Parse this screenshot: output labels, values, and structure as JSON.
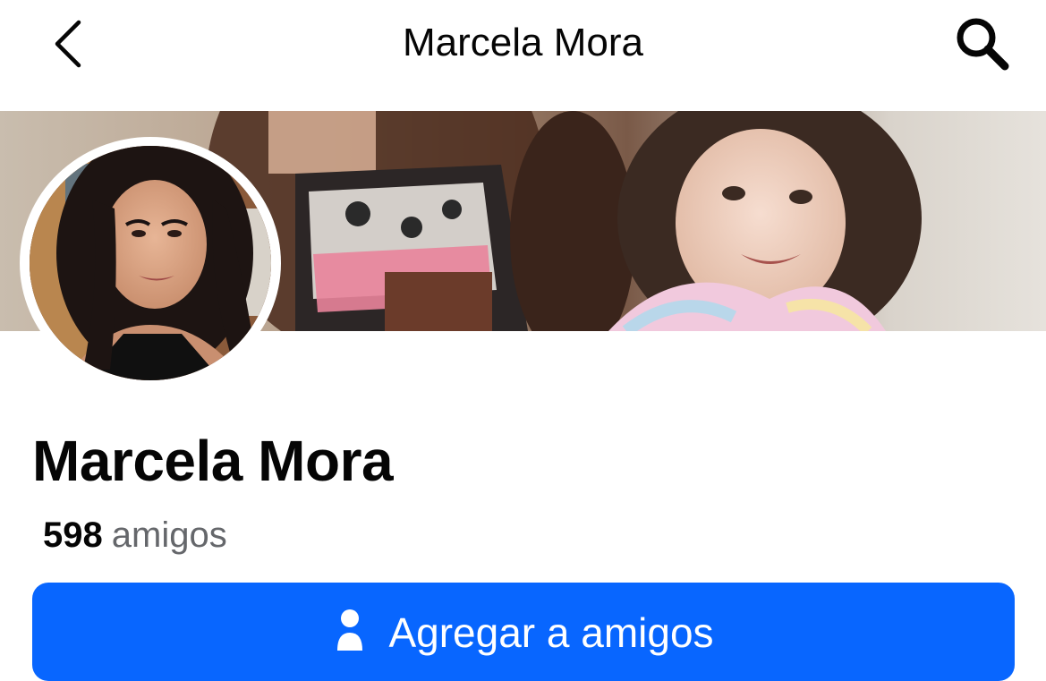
{
  "header": {
    "title": "Marcela Mora",
    "back_icon": "chevron-left-icon",
    "search_icon": "search-icon"
  },
  "profile": {
    "name": "Marcela Mora",
    "friends_count": "598",
    "friends_label": "amigos"
  },
  "actions": {
    "add_friend_label": "Agregar a amigos",
    "add_friend_icon": "person-add-icon"
  },
  "colors": {
    "primary_button": "#0866ff",
    "secondary_text": "#65676b",
    "text": "#050505"
  }
}
